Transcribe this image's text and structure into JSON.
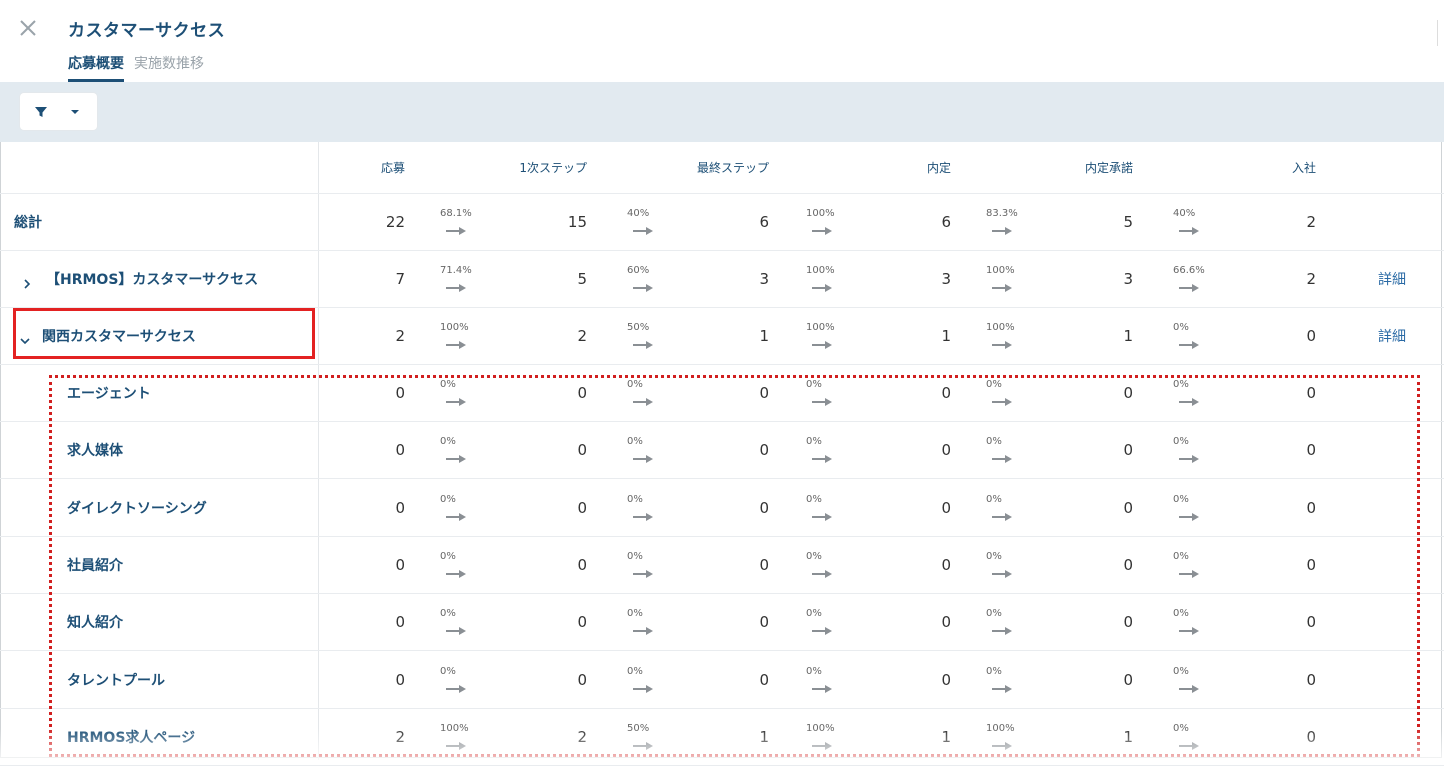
{
  "header": {
    "title": "カスタマーサクセス",
    "tabs": [
      {
        "label": "応募概要",
        "active": true
      },
      {
        "label": "実施数推移",
        "active": false
      }
    ]
  },
  "toolbar": {
    "filter_icon": "filter-icon",
    "dropdown_icon": "caret-down-icon"
  },
  "table": {
    "columns": [
      "応募",
      "1次ステップ",
      "最終ステップ",
      "内定",
      "内定承諾",
      "入社"
    ],
    "rows": [
      {
        "name": "総計",
        "values": [
          "22",
          "15",
          "6",
          "6",
          "5",
          "2"
        ],
        "rates": [
          "68.1%",
          "40%",
          "100%",
          "83.3%",
          "40%"
        ],
        "detail": ""
      },
      {
        "name": "【HRMOS】カスタマーサクセス",
        "values": [
          "7",
          "5",
          "3",
          "3",
          "3",
          "2"
        ],
        "rates": [
          "71.4%",
          "60%",
          "100%",
          "100%",
          "66.6%"
        ],
        "detail": "詳細",
        "expander": "chevron-right-icon"
      },
      {
        "name": "関西カスタマーサクセス",
        "values": [
          "2",
          "2",
          "1",
          "1",
          "1",
          "0"
        ],
        "rates": [
          "100%",
          "50%",
          "100%",
          "100%",
          "0%"
        ],
        "detail": "詳細",
        "expander": "chevron-down-icon"
      },
      {
        "name": "エージェント",
        "values": [
          "0",
          "0",
          "0",
          "0",
          "0",
          "0"
        ],
        "rates": [
          "0%",
          "0%",
          "0%",
          "0%",
          "0%"
        ],
        "detail": ""
      },
      {
        "name": "求人媒体",
        "values": [
          "0",
          "0",
          "0",
          "0",
          "0",
          "0"
        ],
        "rates": [
          "0%",
          "0%",
          "0%",
          "0%",
          "0%"
        ],
        "detail": ""
      },
      {
        "name": "ダイレクトソーシング",
        "values": [
          "0",
          "0",
          "0",
          "0",
          "0",
          "0"
        ],
        "rates": [
          "0%",
          "0%",
          "0%",
          "0%",
          "0%"
        ],
        "detail": ""
      },
      {
        "name": "社員紹介",
        "values": [
          "0",
          "0",
          "0",
          "0",
          "0",
          "0"
        ],
        "rates": [
          "0%",
          "0%",
          "0%",
          "0%",
          "0%"
        ],
        "detail": ""
      },
      {
        "name": "知人紹介",
        "values": [
          "0",
          "0",
          "0",
          "0",
          "0",
          "0"
        ],
        "rates": [
          "0%",
          "0%",
          "0%",
          "0%",
          "0%"
        ],
        "detail": ""
      },
      {
        "name": "タレントプール",
        "values": [
          "0",
          "0",
          "0",
          "0",
          "0",
          "0"
        ],
        "rates": [
          "0%",
          "0%",
          "0%",
          "0%",
          "0%"
        ],
        "detail": ""
      },
      {
        "name": "HRMOS求人ページ",
        "values": [
          "2",
          "2",
          "1",
          "1",
          "1",
          "0"
        ],
        "rates": [
          "100%",
          "50%",
          "100%",
          "100%",
          "0%"
        ],
        "detail": ""
      }
    ]
  },
  "colors": {
    "accent": "#1d4f76",
    "link": "#2a6aa5",
    "toolbar_bg": "#e2eaf0",
    "highlight_red": "#e32222"
  }
}
